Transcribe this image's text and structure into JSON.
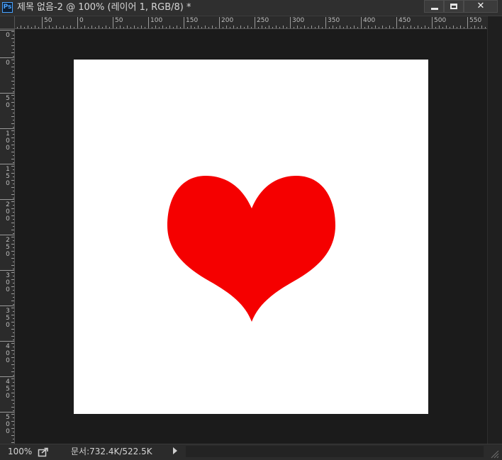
{
  "window": {
    "app_icon_text": "Ps",
    "title": "제목 없음-2 @ 100% (레이어 1, RGB/8) *",
    "close_label": "✕"
  },
  "rulers": {
    "top_labels": [
      "0",
      "50",
      "0",
      "50",
      "100",
      "150",
      "200",
      "250",
      "300",
      "350",
      "400",
      "450",
      "500",
      "550"
    ],
    "left_labels": [
      "0",
      "0",
      "50",
      "100",
      "150",
      "200",
      "250",
      "300",
      "350",
      "400",
      "450",
      "500"
    ]
  },
  "canvas": {
    "background_color": "#ffffff",
    "shape": "heart-shape",
    "shape_color": "#f50000"
  },
  "status": {
    "zoom": "100%",
    "doc_size": "문서:732.4K/522.5K"
  }
}
